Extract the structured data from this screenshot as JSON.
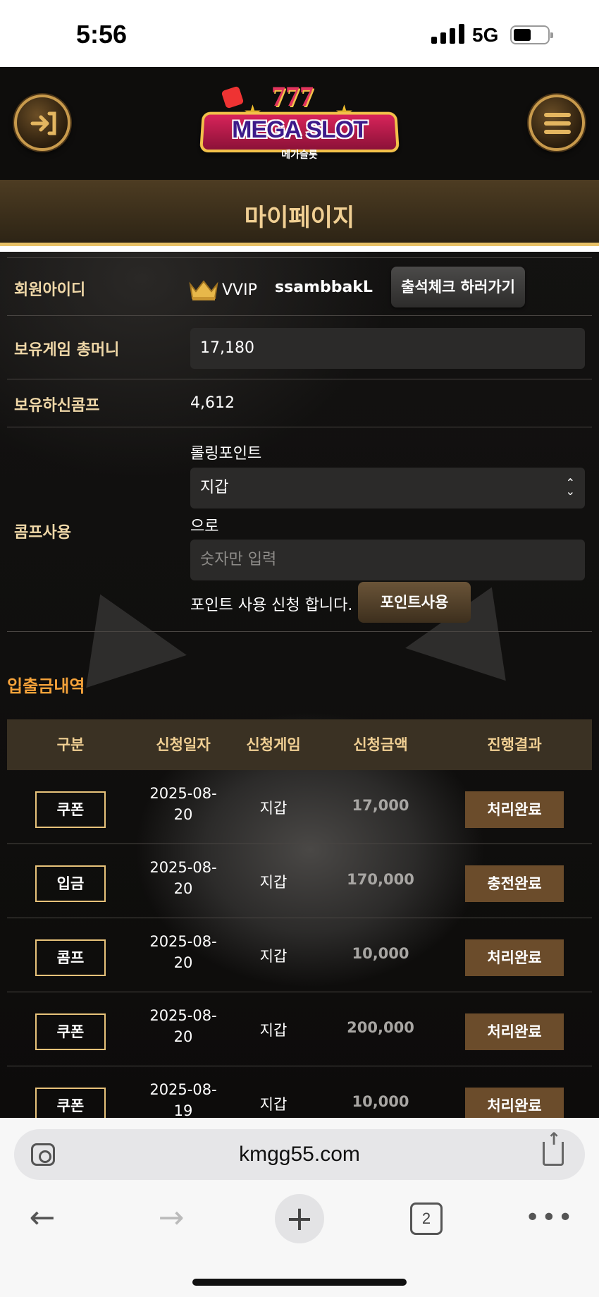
{
  "status_bar": {
    "time": "5:56",
    "network": "5G"
  },
  "header": {
    "logo_text": "MEGA SLOT",
    "logo_sub": "메가슬롯",
    "logo_777": "777"
  },
  "page_title": "마이페이지",
  "member": {
    "id_label": "회원아이디",
    "level": "VVIP",
    "username": "ssambbakL",
    "attendance_button": "출석체크 하러가기",
    "money_label": "보유게임 총머니",
    "money_value": "17,180",
    "comp_label": "보유하신콤프",
    "comp_value": "4,612",
    "use_label": "콤프사용",
    "rolling_label": "롤링포인트",
    "wallet_select": "지갑",
    "to_label": "으로",
    "amount_placeholder": "숫자만 입력",
    "apply_text": "포인트 사용 신청 합니다.",
    "apply_button": "포인트사용"
  },
  "history": {
    "title": "입출금내역",
    "columns": [
      "구분",
      "신청일자",
      "신청게임",
      "신청금액",
      "진행결과"
    ],
    "rows": [
      {
        "type": "쿠폰",
        "date_1": "2025-08-",
        "date_2": "20",
        "game": "지갑",
        "amount": "17,000",
        "result": "처리완료"
      },
      {
        "type": "입금",
        "date_1": "2025-08-",
        "date_2": "20",
        "game": "지갑",
        "amount": "170,000",
        "result": "충전완료"
      },
      {
        "type": "콤프",
        "date_1": "2025-08-",
        "date_2": "20",
        "game": "지갑",
        "amount": "10,000",
        "result": "처리완료"
      },
      {
        "type": "쿠폰",
        "date_1": "2025-08-",
        "date_2": "20",
        "game": "지갑",
        "amount": "200,000",
        "result": "처리완료"
      },
      {
        "type": "쿠폰",
        "date_1": "2025-08-",
        "date_2": "19",
        "game": "지갑",
        "amount": "10,000",
        "result": "처리완료"
      }
    ]
  },
  "browser": {
    "url": "kmgg55.com",
    "tab_count": "2"
  },
  "colors": {
    "gold": "#e8c167",
    "orange_title": "#f5a23a",
    "result_brown": "#6b4c2b"
  }
}
